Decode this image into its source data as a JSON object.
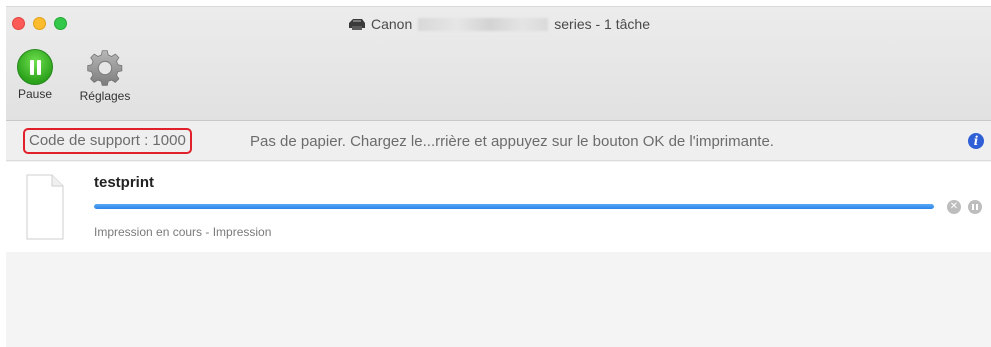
{
  "window": {
    "title_prefix": "Canon",
    "title_suffix": "series - 1 tâche"
  },
  "toolbar": {
    "pause_label": "Pause",
    "settings_label": "Réglages"
  },
  "status": {
    "support_code": "Code de support : 1000",
    "message": "Pas de papier. Chargez le...rrière et appuyez sur le bouton OK de l'imprimante."
  },
  "job": {
    "name": "testprint",
    "progress": 1.0,
    "status": "Impression en cours - Impression"
  },
  "colors": {
    "pause_green": "#2da21c",
    "highlight_red": "#e0202a",
    "progress_blue": "#2b85e8",
    "info_blue": "#2f5fd6"
  },
  "icons": {
    "printer": "printer-icon",
    "pause": "pause-icon",
    "settings": "gear-icon",
    "info": "info-icon",
    "document": "document-icon",
    "cancel": "cancel-icon",
    "hold": "hold-icon"
  }
}
